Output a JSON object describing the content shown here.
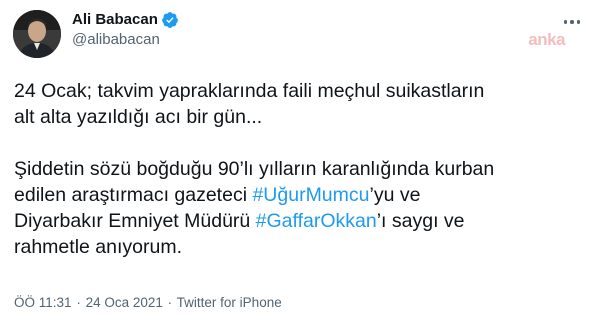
{
  "author": {
    "name": "Ali Babacan",
    "handle": "@alibabacan",
    "verified_icon": "verified-badge-icon",
    "verified_color": "#1d9bf0"
  },
  "watermark": "anka",
  "tweet": {
    "line1": "24 Ocak; takvim yapraklarında faili meçhul suikastların",
    "line2": "alt alta yazıldığı acı bir gün...",
    "line3": "Şiddetin sözü boğduğu 90’lı yılların karanlığında kurban",
    "line4_pre": "edilen araştırmacı gazeteci ",
    "hashtag1": "#UğurMumcu",
    "line4_post": "’yu ve",
    "line5_pre": "Diyarbakır Emniyet Müdürü ",
    "hashtag2": "#GaffarOkkan",
    "line5_post": "’ı saygı ve",
    "line6": "rahmetle anıyorum."
  },
  "meta": {
    "time": "ÖÖ 11:31",
    "separator1": "·",
    "date": "24 Oca 2021",
    "separator2": "·",
    "source": "Twitter for iPhone"
  },
  "colors": {
    "text": "#0f1419",
    "secondary": "#536471",
    "link": "#1d9bf0"
  }
}
